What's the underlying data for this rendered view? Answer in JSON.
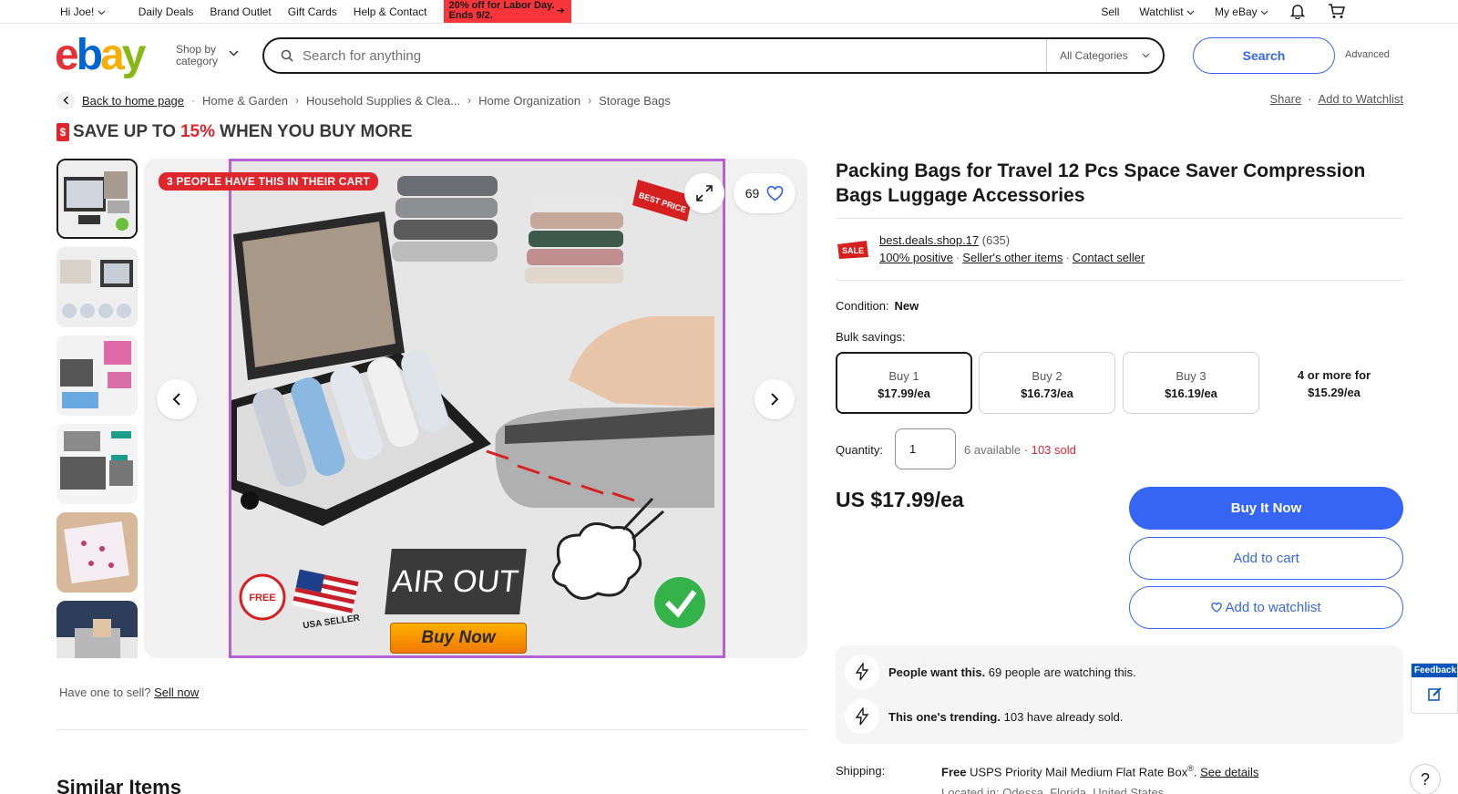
{
  "topnav": {
    "greeting": "Hi Joe!",
    "links": [
      "Daily Deals",
      "Brand Outlet",
      "Gift Cards",
      "Help & Contact"
    ],
    "promo": "20% off for Labor Day. Ends 9/2.",
    "right_links": [
      "Sell",
      "Watchlist",
      "My eBay"
    ],
    "icons": [
      "bell-icon",
      "cart-icon"
    ]
  },
  "header": {
    "logo": {
      "e": "e",
      "b": "b",
      "a": "a",
      "y": "y"
    },
    "shop_by_category": "Shop by category",
    "search_placeholder": "Search for anything",
    "category_select": "All Categories",
    "search_button": "Search",
    "advanced": "Advanced"
  },
  "breadcrumb": {
    "back": "Back to home page",
    "items": [
      "Home & Garden",
      "Household Supplies & Clea...",
      "Home Organization",
      "Storage Bags"
    ],
    "share": "Share",
    "add_watchlist": "Add to Watchlist"
  },
  "save_banner": {
    "prefix": "SAVE UP TO",
    "percent": "15%",
    "suffix": "WHEN YOU BUY MORE"
  },
  "gallery": {
    "cart_badge": "3 PEOPLE HAVE THIS IN THEIR CART",
    "watch_count": "69",
    "image_text": {
      "air_out": "AIR OUT",
      "buy_now": "Buy Now",
      "best_price": "BEST PRICE",
      "free": "FREE",
      "usa": "USA SELLER"
    }
  },
  "have_one": {
    "text": "Have one to sell?",
    "link": "Sell now"
  },
  "similar_items": "Similar Items",
  "product": {
    "title": "Packing Bags for Travel 12 Pcs Space Saver Compression Bags Luggage Accessories",
    "seller": {
      "name": "best.deals.shop.17",
      "count": "(635)",
      "positive": "100% positive",
      "other_items": "Seller's other items",
      "contact": "Contact seller"
    },
    "condition_label": "Condition:",
    "condition": "New",
    "bulk_label": "Bulk savings:",
    "bulk": [
      {
        "label": "Buy 1",
        "price": "$17.99/ea"
      },
      {
        "label": "Buy 2",
        "price": "$16.73/ea"
      },
      {
        "label": "Buy 3",
        "price": "$16.19/ea"
      },
      {
        "label": "4 or more for",
        "price": "$15.29/ea"
      }
    ],
    "quantity_label": "Quantity:",
    "quantity": "1",
    "available": "6 available",
    "sold": "· 103 sold",
    "price": "US $17.99/ea",
    "buy_now": "Buy It Now",
    "add_cart": "Add to cart",
    "add_watchlist": "Add to watchlist",
    "signals": [
      {
        "bold": "People want this.",
        "text": " 69 people are watching this."
      },
      {
        "bold": "This one's trending.",
        "text": " 103 have already sold."
      }
    ],
    "shipping_label": "Shipping:",
    "shipping_free": "Free",
    "shipping_text": " USPS Priority Mail Medium Flat Rate Box",
    "shipping_reg": "®",
    "shipping_details": "See details",
    "location": "Located in: Odessa, Florida, United States"
  },
  "feedback": "Feedback",
  "help": "?",
  "colors": {
    "accent": "#3665f3",
    "sale_red": "#e0262d",
    "highlight": "#b660d8"
  }
}
